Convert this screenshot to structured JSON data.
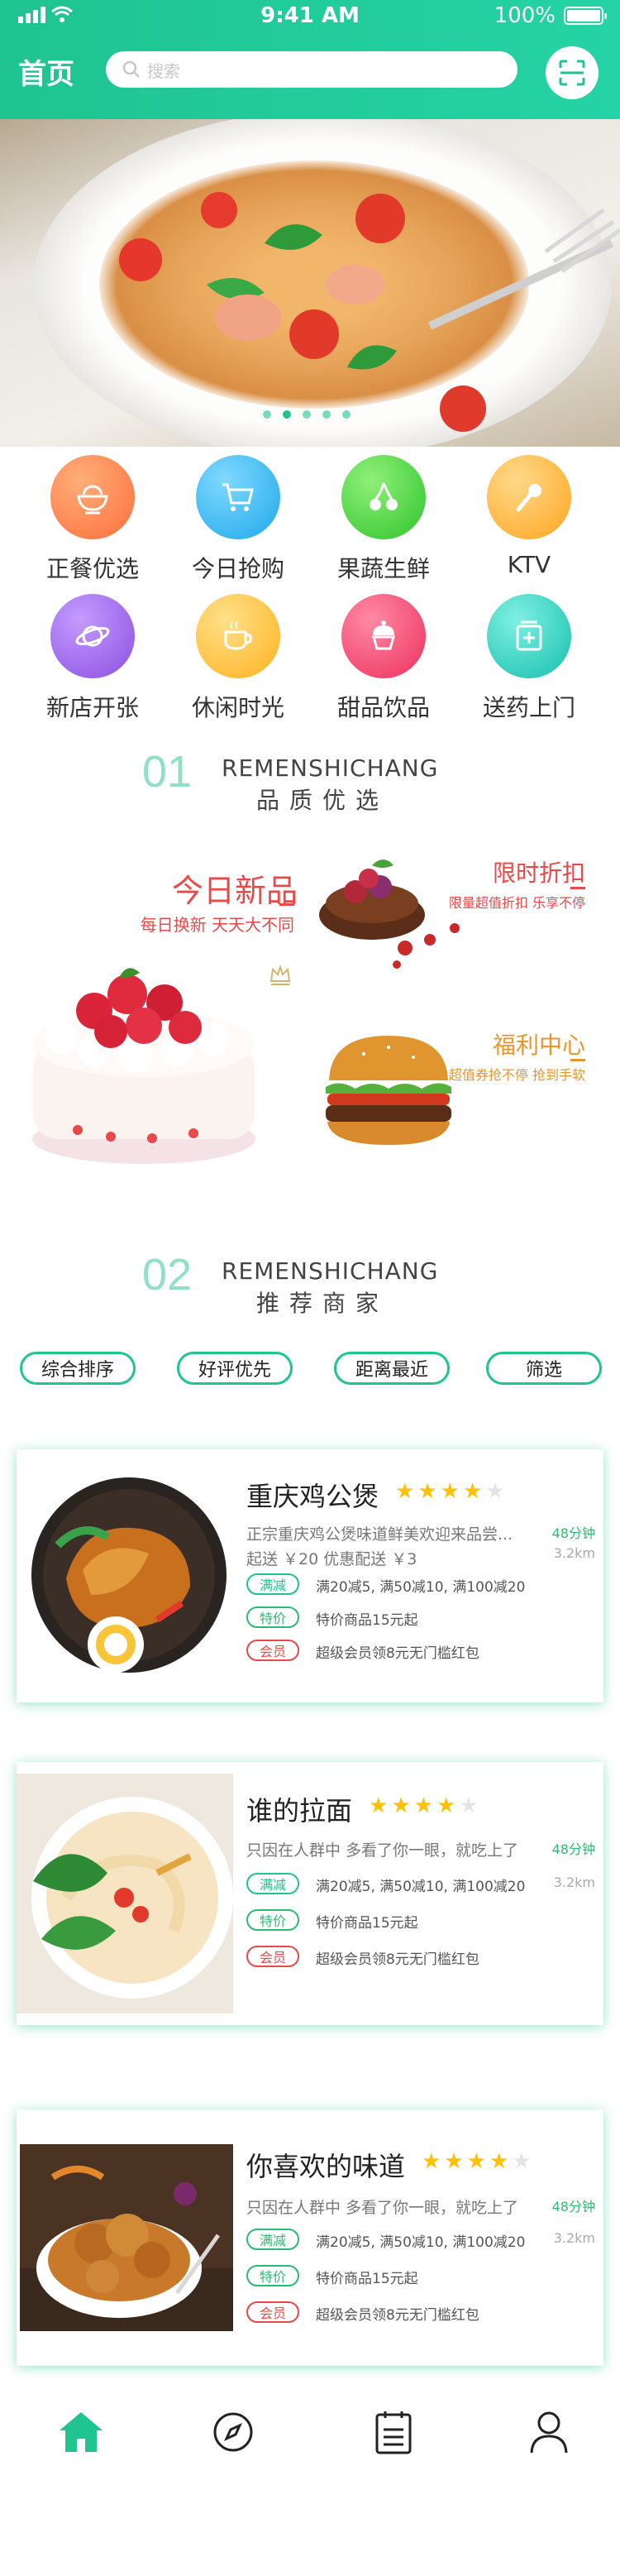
{
  "status": {
    "time": "9:41 AM",
    "battery": "100%"
  },
  "header": {
    "title": "首页",
    "search_placeholder": "搜索"
  },
  "banner": {
    "dots": 5,
    "active_dot": 1
  },
  "categories": [
    {
      "label": "正餐优选",
      "icon": "rice-bowl-icon",
      "color": "#ff7a3d"
    },
    {
      "label": "今日抢购",
      "icon": "shopping-cart-icon",
      "color": "#2fb8f0"
    },
    {
      "label": "果蔬生鲜",
      "icon": "cherry-icon",
      "color": "#3ccf3c"
    },
    {
      "label": "KTV",
      "icon": "microphone-icon",
      "color": "#ffb32a"
    },
    {
      "label": "新店开张",
      "icon": "planet-icon",
      "color": "#9b5de5"
    },
    {
      "label": "休闲时光",
      "icon": "coffee-cup-icon",
      "color": "#ffb32a"
    },
    {
      "label": "甜品饮品",
      "icon": "cupcake-icon",
      "color": "#f0406a"
    },
    {
      "label": "送药上门",
      "icon": "medicine-box-icon",
      "color": "#22c9b8"
    }
  ],
  "sections": [
    {
      "num": "01",
      "en": "REMENSHICHANG",
      "cn": "品质优选"
    },
    {
      "num": "02",
      "en": "REMENSHICHANG",
      "cn": "推荐商家"
    }
  ],
  "promos": {
    "main": {
      "title": "今日新品",
      "sub": "每日换新  天天大不同"
    },
    "discount": {
      "title": "限时折扣",
      "sub": "限量超值折扣 乐享不停"
    },
    "welfare": {
      "title": "福利中心",
      "sub": "超值券抢不停 抢到手软"
    }
  },
  "filters": [
    "综合排序",
    "好评优先",
    "距离最近",
    "筛选"
  ],
  "shops": [
    {
      "name": "重庆鸡公煲",
      "rating": 4,
      "desc1": "正宗重庆鸡公煲味道鲜美欢迎来品尝...",
      "desc2": "起送 ￥20       优惠配送 ￥3",
      "time": "48分钟",
      "distance": "3.2km",
      "tags": [
        {
          "label": "满减",
          "text": "满20减5, 满50减10, 满100减20"
        },
        {
          "label": "特价",
          "text": "特价商品15元起"
        },
        {
          "label": "会员",
          "text": "超级会员领8元无门槛红包"
        }
      ]
    },
    {
      "name": "谁的拉面",
      "rating": 4,
      "desc1": "只因在人群中 多看了你一眼，就吃上了",
      "time": "48分钟",
      "distance": "3.2km",
      "tags": [
        {
          "label": "满减",
          "text": "满20减5, 满50减10, 满100减20"
        },
        {
          "label": "特价",
          "text": "特价商品15元起"
        },
        {
          "label": "会员",
          "text": "超级会员领8元无门槛红包"
        }
      ]
    },
    {
      "name": "你喜欢的味道",
      "rating": 4,
      "desc1": "只因在人群中 多看了你一眼，就吃上了",
      "time": "48分钟",
      "distance": "3.2km",
      "tags": [
        {
          "label": "满减",
          "text": "满20减5, 满50减10, 满100减20"
        },
        {
          "label": "特价",
          "text": "特价商品15元起"
        },
        {
          "label": "会员",
          "text": "超级会员领8元无门槛红包"
        }
      ]
    }
  ],
  "tabbar": [
    {
      "name": "home",
      "icon": "home-icon",
      "active": true
    },
    {
      "name": "discover",
      "icon": "compass-icon",
      "active": false
    },
    {
      "name": "orders",
      "icon": "clipboard-icon",
      "active": false
    },
    {
      "name": "profile",
      "icon": "user-icon",
      "active": false
    }
  ],
  "colors": {
    "accent": "#1fc48f",
    "red": "#e94949",
    "orange": "#e8962a"
  }
}
